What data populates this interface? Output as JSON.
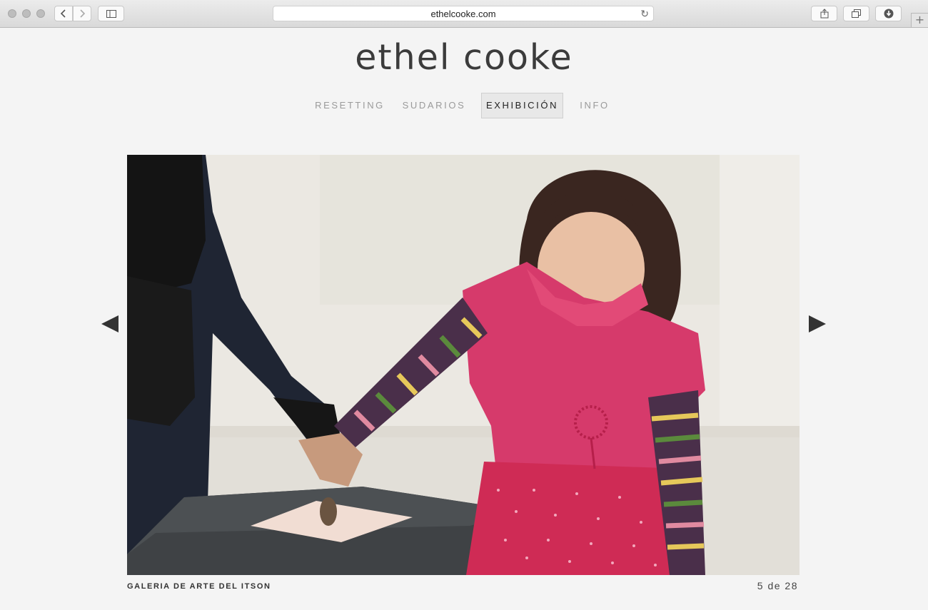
{
  "browser": {
    "url": "ethelcooke.com",
    "icons": [
      "close-dot",
      "minimize-dot",
      "zoom-dot",
      "back-icon",
      "forward-icon",
      "sidebar-icon",
      "reload-icon",
      "share-icon",
      "tabs-icon",
      "download-icon",
      "new-tab-icon"
    ]
  },
  "site": {
    "title": "ethel cooke"
  },
  "nav": {
    "items": [
      {
        "label": "RESETTING",
        "active": false
      },
      {
        "label": "SUDARIOS",
        "active": false
      },
      {
        "label": "EXHIBICIÓN",
        "active": true
      },
      {
        "label": "INFO",
        "active": false
      }
    ]
  },
  "gallery": {
    "caption": "GALERIA DE ARTE DEL ITSON",
    "counter": "5 de 28"
  }
}
